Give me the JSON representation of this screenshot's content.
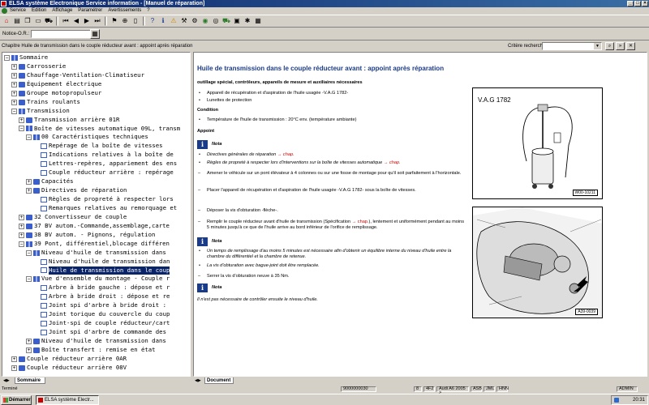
{
  "window": {
    "title": "ELSA système Electronique Service information - [Manuel de réparation]",
    "controls": [
      "_",
      "□",
      "×"
    ]
  },
  "menu": [
    "Service",
    "Edition",
    "Affichage",
    "Paramétrer",
    "Avertissements",
    "?"
  ],
  "toolbar_icons": [
    "home-icon",
    "print-icon",
    "copy-icon",
    "open-icon",
    "car-icon",
    "first-icon",
    "prev-icon",
    "next-icon",
    "last-icon",
    "bookmark-icon",
    "zoom-icon",
    "doc-icon",
    "help-icon",
    "info-icon",
    "warn-icon",
    "tool-icon",
    "settings-icon",
    "globe-icon",
    "wheel-icon",
    "car2-icon",
    "engine-icon",
    "gear-icon",
    "window-icon"
  ],
  "notice": {
    "label": "Notice-O.R.:",
    "value": ""
  },
  "chapter": "Chapitre Huile de transmission dans le couple réducteur avant : appoint après réparation",
  "search": {
    "label": "Critère recherche:",
    "value": ""
  },
  "tree": [
    {
      "t": "Sommaire",
      "d": 0,
      "tg": "-",
      "ic": "bookopen"
    },
    {
      "t": "Carrosserie",
      "d": 1,
      "tg": "+",
      "ic": "book"
    },
    {
      "t": "Chauffage-Ventilation-Climatiseur",
      "d": 1,
      "tg": "+",
      "ic": "book"
    },
    {
      "t": "Équipement électrique",
      "d": 1,
      "tg": "+",
      "ic": "book"
    },
    {
      "t": "Groupe motopropulseur",
      "d": 1,
      "tg": "+",
      "ic": "book"
    },
    {
      "t": "Trains roulants",
      "d": 1,
      "tg": "+",
      "ic": "book"
    },
    {
      "t": "Transmission",
      "d": 1,
      "tg": "-",
      "ic": "bookopen"
    },
    {
      "t": "Transmission arrière 01R",
      "d": 2,
      "tg": "+",
      "ic": "book"
    },
    {
      "t": "Boîte de vitesses automatique 09L, transm",
      "d": 2,
      "tg": "-",
      "ic": "bookopen"
    },
    {
      "t": "00 Caractéristiques techniques",
      "d": 3,
      "tg": "-",
      "ic": "bookopen"
    },
    {
      "t": "Repérage de la boîte de vitesses",
      "d": 4,
      "tg": "",
      "ic": "page"
    },
    {
      "t": "Indications relatives à la boîte de",
      "d": 4,
      "tg": "",
      "ic": "page"
    },
    {
      "t": "Lettres-repères, appariement des ens",
      "d": 4,
      "tg": "",
      "ic": "page"
    },
    {
      "t": "Couple réducteur arrière : repérage",
      "d": 4,
      "tg": "",
      "ic": "page"
    },
    {
      "t": "Capacités",
      "d": 3,
      "tg": "+",
      "ic": "book"
    },
    {
      "t": "Directives de réparation",
      "d": 3,
      "tg": "+",
      "ic": "book"
    },
    {
      "t": "Règles de propreté à respecter lors",
      "d": 4,
      "tg": "",
      "ic": "page"
    },
    {
      "t": "Remarques relatives au remorquage et",
      "d": 4,
      "tg": "",
      "ic": "page"
    },
    {
      "t": "32 Convertisseur de couple",
      "d": 2,
      "tg": "+",
      "ic": "book"
    },
    {
      "t": "37 BV autom.-Commande,assemblage,carte",
      "d": 2,
      "tg": "+",
      "ic": "book"
    },
    {
      "t": "38 BV autom. - Pignons, régulation",
      "d": 2,
      "tg": "+",
      "ic": "book"
    },
    {
      "t": "39 Pont, différentiel,blocage différen",
      "d": 2,
      "tg": "-",
      "ic": "bookopen"
    },
    {
      "t": "Niveau d'huile de transmission dans",
      "d": 3,
      "tg": "-",
      "ic": "bookopen"
    },
    {
      "t": "Niveau d'huile de transmission dan",
      "d": 4,
      "tg": "",
      "ic": "page"
    },
    {
      "t": "Huile de transmission dans le coup",
      "d": 4,
      "tg": "",
      "ic": "page",
      "sel": true
    },
    {
      "t": "Vue d'ensemble du montage - Couple r",
      "d": 3,
      "tg": "-",
      "ic": "bookopen"
    },
    {
      "t": "Arbre à bride gauche : dépose et r",
      "d": 4,
      "tg": "",
      "ic": "page"
    },
    {
      "t": "Arbre à bride droit : dépose et re",
      "d": 4,
      "tg": "",
      "ic": "page"
    },
    {
      "t": "Joint spi d'arbre à bride droit :",
      "d": 4,
      "tg": "",
      "ic": "page"
    },
    {
      "t": "Joint torique du couvercle du coup",
      "d": 4,
      "tg": "",
      "ic": "page"
    },
    {
      "t": "Joint-spi de couple réducteur/cart",
      "d": 4,
      "tg": "",
      "ic": "page"
    },
    {
      "t": "Joint spi d'arbre de commande des",
      "d": 4,
      "tg": "",
      "ic": "page"
    },
    {
      "t": "Niveau d'huile de transmission dans",
      "d": 3,
      "tg": "+",
      "ic": "book"
    },
    {
      "t": "Boîte transfert : remise en état",
      "d": 3,
      "tg": "+",
      "ic": "book"
    },
    {
      "t": "Couple réducteur arrière 0AR",
      "d": 1,
      "tg": "+",
      "ic": "book"
    },
    {
      "t": "Couple réducteur arrière 08V",
      "d": 1,
      "tg": "+",
      "ic": "book"
    }
  ],
  "left_tab": "Sommaire",
  "right_tab": "Document",
  "doc": {
    "title": "Huile de transmission dans le couple réducteur avant : appoint après réparation",
    "subtitle": "outillage spécial, contrôleurs, appareils de mesure et auxiliaires nécessaires",
    "tools": [
      "Appareil de récupération et d'aspiration de l'huile usagée -V.A.G 1782-",
      "Lunettes de protection"
    ],
    "condition_h": "Condition",
    "condition": "Température de l'huile de transmission : 20°C env. (température ambiante)",
    "appoint_h": "Appoint",
    "note_label": "Nota",
    "note1_a": "Directives générales de réparation",
    "note1_b": "chap.",
    "note2_a": "Règles de propreté à respecter lors d'interventions sur la boîte de vitesses automatique",
    "note2_b": "chap.",
    "step1": "Amener le véhicule sur un pont élévateur à 4 colonnes ou sur une fosse de montage pour qu'il soit parfaitement à l'horizontale.",
    "step2": "Placer l'appareil de récupération et d'aspiration de l'huile usagée -V.A.G 1782- sous la boîte de vitesses.",
    "step3": "Déposer la vis d'obturation -flèche-.",
    "step4_a": "Remplir le couple réducteur avant d'huile de transmission (Spécification",
    "step4_b": "chap.",
    "step4_c": "), lentement et uniformément pendant au moins 5 minutes jusqu'à ce que de l'huile arrive au bord inférieur de l'orifice de remplissage.",
    "note3_1": "Un temps de remplissage d'au moins 5 minutes est nécessaire afin d'obtenir un équilibre interne du niveau d'huile entre la chambre du différentiel et la chambre de retenue.",
    "note3_2": "La vis d'obturation avec bague-joint doit être remplacée.",
    "step5": "Serrer la vis d'obturation neuve à 35 Nm.",
    "note4": "Il n'est pas nécessaire de contrôler ensuite le niveau d'huile.",
    "fig1_label": "V.A.G 1782",
    "fig1_tag": "W00-10211",
    "fig2_tag": "A39-0039"
  },
  "status": {
    "left": "Terminé",
    "cells": [
      "9000000030",
      "8",
      "4F2",
      "Audi A6 2005 >",
      "ASB",
      "JML",
      "HNN",
      "ADMIN"
    ]
  },
  "taskbar": {
    "start": "Démarrer",
    "item": "ELSA système Electr...",
    "time": "20:31"
  }
}
